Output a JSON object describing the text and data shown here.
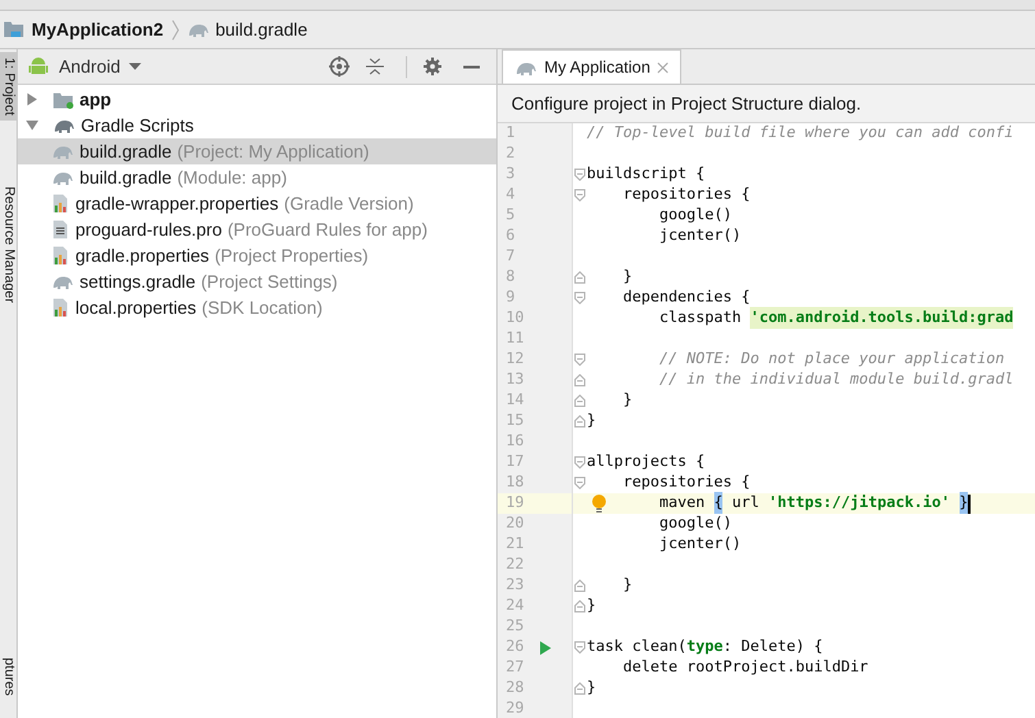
{
  "side_stripe": [
    {
      "label": "1: Project",
      "selected": true
    },
    {
      "label": "Resource Manager",
      "selected": false
    },
    {
      "label": "ptures",
      "selected": false
    }
  ],
  "breadcrumb": {
    "project": "MyApplication2",
    "file": "build.gradle"
  },
  "project_panel": {
    "view": "Android",
    "tree": [
      {
        "label": "app",
        "kind": "module",
        "bold": true,
        "expanded": false,
        "selected": false
      },
      {
        "label": "Gradle Scripts",
        "kind": "group",
        "bold": false,
        "expanded": true,
        "selected": false,
        "children": [
          {
            "label": "build.gradle",
            "hint": "(Project: My Application)",
            "kind": "gradle",
            "selected": true
          },
          {
            "label": "build.gradle",
            "hint": "(Module: app)",
            "kind": "gradle",
            "selected": false
          },
          {
            "label": "gradle-wrapper.properties",
            "hint": "(Gradle Version)",
            "kind": "properties",
            "selected": false
          },
          {
            "label": "proguard-rules.pro",
            "hint": "(ProGuard Rules for app)",
            "kind": "text",
            "selected": false
          },
          {
            "label": "gradle.properties",
            "hint": "(Project Properties)",
            "kind": "properties",
            "selected": false
          },
          {
            "label": "settings.gradle",
            "hint": "(Project Settings)",
            "kind": "gradle",
            "selected": false
          },
          {
            "label": "local.properties",
            "hint": "(SDK Location)",
            "kind": "properties",
            "selected": false
          }
        ]
      }
    ]
  },
  "editor": {
    "tabs": [
      {
        "label": "My Application",
        "selected": true
      }
    ],
    "banner": "Configure project in Project Structure dialog.",
    "lines": [
      {
        "n": "1",
        "fold_open": false,
        "fold_close": false,
        "run": false,
        "bulb": false,
        "current": false,
        "cursor": false,
        "segs": [
          {
            "kind": "comment",
            "text": "// Top-level build file where you can add confi"
          }
        ]
      },
      {
        "n": "2",
        "fold_open": false,
        "fold_close": false,
        "run": false,
        "bulb": false,
        "current": false,
        "cursor": false
      },
      {
        "n": "3",
        "fold_open": true,
        "fold_close": false,
        "run": false,
        "bulb": false,
        "current": false,
        "cursor": false,
        "segs": [
          {
            "kind": "plain",
            "text": "buildscript {"
          }
        ]
      },
      {
        "n": "4",
        "fold_open": true,
        "fold_close": false,
        "run": false,
        "bulb": false,
        "current": false,
        "cursor": false,
        "segs": [
          {
            "kind": "plain",
            "text": "    repositories {"
          }
        ]
      },
      {
        "n": "5",
        "fold_open": false,
        "fold_close": false,
        "run": false,
        "bulb": false,
        "current": false,
        "cursor": false,
        "segs": [
          {
            "kind": "plain",
            "text": "        google()"
          }
        ]
      },
      {
        "n": "6",
        "fold_open": false,
        "fold_close": false,
        "run": false,
        "bulb": false,
        "current": false,
        "cursor": false,
        "segs": [
          {
            "kind": "plain",
            "text": "        jcenter()"
          }
        ]
      },
      {
        "n": "7",
        "fold_open": false,
        "fold_close": false,
        "run": false,
        "bulb": false,
        "current": false,
        "cursor": false
      },
      {
        "n": "8",
        "fold_open": false,
        "fold_close": true,
        "run": false,
        "bulb": false,
        "current": false,
        "cursor": false,
        "segs": [
          {
            "kind": "plain",
            "text": "    }"
          }
        ]
      },
      {
        "n": "9",
        "fold_open": true,
        "fold_close": false,
        "run": false,
        "bulb": false,
        "current": false,
        "cursor": false,
        "segs": [
          {
            "kind": "plain",
            "text": "    dependencies {"
          }
        ]
      },
      {
        "n": "10",
        "fold_open": false,
        "fold_close": false,
        "run": false,
        "bulb": false,
        "current": false,
        "cursor": false,
        "segs": [
          {
            "kind": "plain",
            "text": "        classpath "
          },
          {
            "kind": "string-warning",
            "text": "'com.android.tools.build:grad"
          }
        ]
      },
      {
        "n": "11",
        "fold_open": false,
        "fold_close": false,
        "run": false,
        "bulb": false,
        "current": false,
        "cursor": false
      },
      {
        "n": "12",
        "fold_open": true,
        "fold_close": false,
        "run": false,
        "bulb": false,
        "current": false,
        "cursor": false,
        "segs": [
          {
            "kind": "comment",
            "text": "        // NOTE: Do not place your application"
          }
        ]
      },
      {
        "n": "13",
        "fold_open": false,
        "fold_close": true,
        "run": false,
        "bulb": false,
        "current": false,
        "cursor": false,
        "segs": [
          {
            "kind": "comment",
            "text": "        // in the individual module build.gradl"
          }
        ]
      },
      {
        "n": "14",
        "fold_open": false,
        "fold_close": true,
        "run": false,
        "bulb": false,
        "current": false,
        "cursor": false,
        "segs": [
          {
            "kind": "plain",
            "text": "    }"
          }
        ]
      },
      {
        "n": "15",
        "fold_open": false,
        "fold_close": true,
        "run": false,
        "bulb": false,
        "current": false,
        "cursor": false,
        "segs": [
          {
            "kind": "plain",
            "text": "}"
          }
        ]
      },
      {
        "n": "16",
        "fold_open": false,
        "fold_close": false,
        "run": false,
        "bulb": false,
        "current": false,
        "cursor": false
      },
      {
        "n": "17",
        "fold_open": true,
        "fold_close": false,
        "run": false,
        "bulb": false,
        "current": false,
        "cursor": false,
        "segs": [
          {
            "kind": "plain",
            "text": "allprojects {"
          }
        ]
      },
      {
        "n": "18",
        "fold_open": true,
        "fold_close": false,
        "run": false,
        "bulb": false,
        "current": false,
        "cursor": false,
        "segs": [
          {
            "kind": "plain",
            "text": "    repositories {"
          }
        ]
      },
      {
        "n": "19",
        "fold_open": false,
        "fold_close": false,
        "run": false,
        "bulb": true,
        "current": true,
        "cursor": true,
        "segs": [
          {
            "kind": "plain",
            "text": "        maven "
          },
          {
            "kind": "brace-match",
            "text": "{"
          },
          {
            "kind": "plain",
            "text": " url "
          },
          {
            "kind": "string",
            "text": "'https://jitpack.io' "
          },
          {
            "kind": "brace-match",
            "text": "}"
          }
        ]
      },
      {
        "n": "20",
        "fold_open": false,
        "fold_close": false,
        "run": false,
        "bulb": false,
        "current": false,
        "cursor": false,
        "segs": [
          {
            "kind": "plain",
            "text": "        google()"
          }
        ]
      },
      {
        "n": "21",
        "fold_open": false,
        "fold_close": false,
        "run": false,
        "bulb": false,
        "current": false,
        "cursor": false,
        "segs": [
          {
            "kind": "plain",
            "text": "        jcenter()"
          }
        ]
      },
      {
        "n": "22",
        "fold_open": false,
        "fold_close": false,
        "run": false,
        "bulb": false,
        "current": false,
        "cursor": false
      },
      {
        "n": "23",
        "fold_open": false,
        "fold_close": true,
        "run": false,
        "bulb": false,
        "current": false,
        "cursor": false,
        "segs": [
          {
            "kind": "plain",
            "text": "    }"
          }
        ]
      },
      {
        "n": "24",
        "fold_open": false,
        "fold_close": true,
        "run": false,
        "bulb": false,
        "current": false,
        "cursor": false,
        "segs": [
          {
            "kind": "plain",
            "text": "}"
          }
        ]
      },
      {
        "n": "25",
        "fold_open": false,
        "fold_close": false,
        "run": false,
        "bulb": false,
        "current": false,
        "cursor": false
      },
      {
        "n": "26",
        "fold_open": true,
        "fold_close": false,
        "run": true,
        "bulb": false,
        "current": false,
        "cursor": false,
        "segs": [
          {
            "kind": "plain",
            "text": "task clean("
          },
          {
            "kind": "keyword",
            "text": "type"
          },
          {
            "kind": "plain",
            "text": ": Delete) {"
          }
        ]
      },
      {
        "n": "27",
        "fold_open": false,
        "fold_close": false,
        "run": false,
        "bulb": false,
        "current": false,
        "cursor": false,
        "segs": [
          {
            "kind": "plain",
            "text": "    delete rootProject.buildDir"
          }
        ]
      },
      {
        "n": "28",
        "fold_open": false,
        "fold_close": true,
        "run": false,
        "bulb": false,
        "current": false,
        "cursor": false,
        "segs": [
          {
            "kind": "plain",
            "text": "}"
          }
        ]
      },
      {
        "n": "29",
        "fold_open": false,
        "fold_close": false,
        "run": false,
        "bulb": false,
        "current": false,
        "cursor": false
      }
    ]
  }
}
